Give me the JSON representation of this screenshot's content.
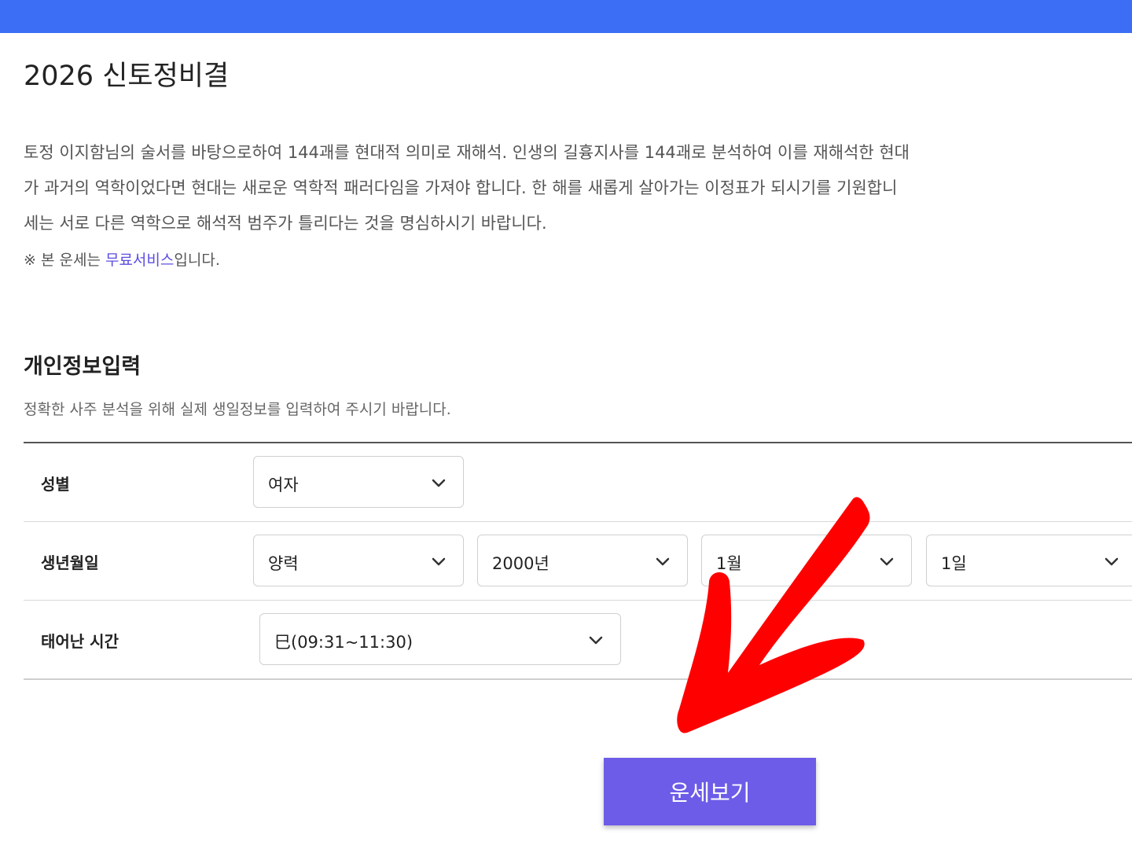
{
  "header": {
    "accent_color": "#3b6ef5"
  },
  "page_title": "2026 신토정비결",
  "description": {
    "line1": "토정 이지함님의 술서를 바탕으로하여 144괘를 현대적 의미로 재해석. 인생의 길흉지사를 144괘로 분석하여 이를 재해석한 현대",
    "line2": "가 과거의 역학이었다면 현대는 새로운 역학적 패러다임을 가져야 합니다. 한 해를 새롭게 살아가는 이정표가 되시기를 기원합니",
    "line3": "세는 서로 다른 역학으로 해석적 범주가 틀리다는 것을 명심하시기 바랍니다."
  },
  "notice": {
    "prefix": "※ 본 운세는 ",
    "highlight": "무료서비스",
    "suffix": "입니다."
  },
  "section": {
    "title": "개인정보입력",
    "subtitle": "정확한 사주 분석을 위해 실제 생일정보를 입력하여 주시기 바랍니다."
  },
  "form": {
    "gender": {
      "label": "성별",
      "value": "여자"
    },
    "birthdate": {
      "label": "생년월일",
      "calendar": "양력",
      "year": "2000년",
      "month": "1월",
      "day": "1일"
    },
    "birthtime": {
      "label": "태어난 시간",
      "value": "巳(09:31~11:30)"
    }
  },
  "submit": {
    "label": "운세보기",
    "color": "#6d5ce8"
  },
  "annotation": {
    "arrow_icon": "red-arrow-icon",
    "color": "#ff0000"
  }
}
